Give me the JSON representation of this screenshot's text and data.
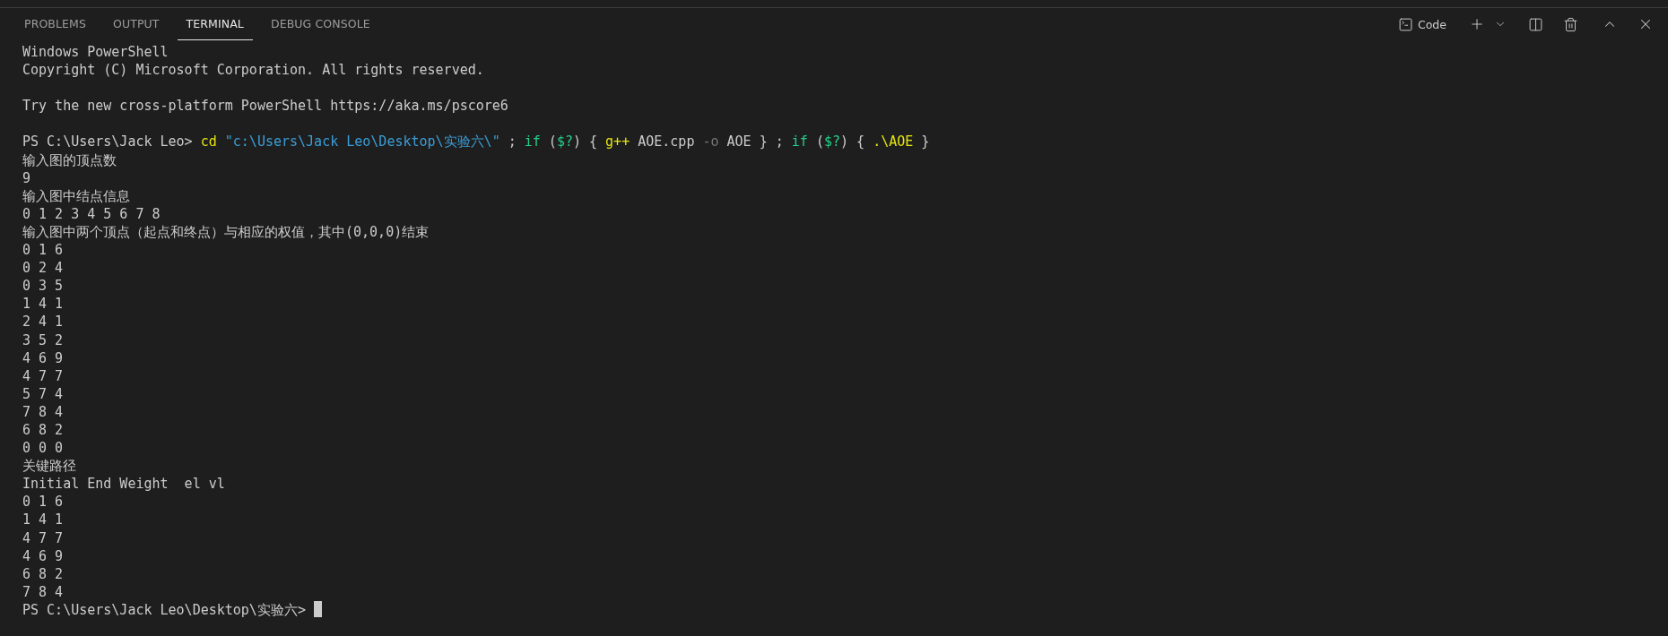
{
  "panel_tabs": [
    {
      "label": "PROBLEMS",
      "selected": false
    },
    {
      "label": "OUTPUT",
      "selected": false
    },
    {
      "label": "TERMINAL",
      "selected": true
    },
    {
      "label": "DEBUG CONSOLE",
      "selected": false
    }
  ],
  "toolbar": {
    "shell_label": "Code"
  },
  "terminal": {
    "cursor": true,
    "lines": [
      {
        "kind": "text",
        "segments": [
          {
            "text": "Windows PowerShell",
            "kind": "plain"
          }
        ]
      },
      {
        "kind": "text",
        "segments": [
          {
            "text": "Copyright (C) Microsoft Corporation. All rights reserved.",
            "kind": "plain"
          }
        ]
      },
      {
        "kind": "blank"
      },
      {
        "kind": "text",
        "segments": [
          {
            "text": "Try the new cross-platform PowerShell https://aka.ms/pscore6",
            "kind": "plain"
          }
        ]
      },
      {
        "kind": "blank"
      },
      {
        "kind": "text",
        "segments": [
          {
            "text": "PS C:\\Users\\Jack Leo> ",
            "kind": "plain"
          },
          {
            "text": "cd",
            "kind": "command"
          },
          {
            "text": " \"c:\\Users\\Jack Leo\\Desktop\\实验六\\\"",
            "kind": "string"
          },
          {
            "text": " ; ",
            "kind": "plain"
          },
          {
            "text": "if",
            "kind": "keyword"
          },
          {
            "text": " (",
            "kind": "plain"
          },
          {
            "text": "$?",
            "kind": "variable"
          },
          {
            "text": ") { ",
            "kind": "plain"
          },
          {
            "text": "g++",
            "kind": "command"
          },
          {
            "text": " AOE.cpp ",
            "kind": "plain"
          },
          {
            "text": "-o",
            "kind": "parameter"
          },
          {
            "text": " AOE } ; ",
            "kind": "plain"
          },
          {
            "text": "if",
            "kind": "keyword"
          },
          {
            "text": " (",
            "kind": "plain"
          },
          {
            "text": "$?",
            "kind": "variable"
          },
          {
            "text": ") { ",
            "kind": "plain"
          },
          {
            "text": ".\\AOE",
            "kind": "command"
          },
          {
            "text": " }",
            "kind": "plain"
          }
        ]
      },
      {
        "kind": "text",
        "segments": [
          {
            "text": "输入图的顶点数",
            "kind": "plain"
          }
        ]
      },
      {
        "kind": "text",
        "segments": [
          {
            "text": "9",
            "kind": "plain"
          }
        ]
      },
      {
        "kind": "text",
        "segments": [
          {
            "text": "输入图中结点信息",
            "kind": "plain"
          }
        ]
      },
      {
        "kind": "text",
        "segments": [
          {
            "text": "0 1 2 3 4 5 6 7 8",
            "kind": "plain"
          }
        ]
      },
      {
        "kind": "text",
        "segments": [
          {
            "text": "输入图中两个顶点（起点和终点）与相应的权值，其中(0,0,0)结束",
            "kind": "plain"
          }
        ]
      },
      {
        "kind": "text",
        "segments": [
          {
            "text": "0 1 6",
            "kind": "plain"
          }
        ]
      },
      {
        "kind": "text",
        "segments": [
          {
            "text": "0 2 4",
            "kind": "plain"
          }
        ]
      },
      {
        "kind": "text",
        "segments": [
          {
            "text": "0 3 5",
            "kind": "plain"
          }
        ]
      },
      {
        "kind": "text",
        "segments": [
          {
            "text": "1 4 1",
            "kind": "plain"
          }
        ]
      },
      {
        "kind": "text",
        "segments": [
          {
            "text": "2 4 1",
            "kind": "plain"
          }
        ]
      },
      {
        "kind": "text",
        "segments": [
          {
            "text": "3 5 2",
            "kind": "plain"
          }
        ]
      },
      {
        "kind": "text",
        "segments": [
          {
            "text": "4 6 9",
            "kind": "plain"
          }
        ]
      },
      {
        "kind": "text",
        "segments": [
          {
            "text": "4 7 7",
            "kind": "plain"
          }
        ]
      },
      {
        "kind": "text",
        "segments": [
          {
            "text": "5 7 4",
            "kind": "plain"
          }
        ]
      },
      {
        "kind": "text",
        "segments": [
          {
            "text": "7 8 4",
            "kind": "plain"
          }
        ]
      },
      {
        "kind": "text",
        "segments": [
          {
            "text": "6 8 2",
            "kind": "plain"
          }
        ]
      },
      {
        "kind": "text",
        "segments": [
          {
            "text": "0 0 0",
            "kind": "plain"
          }
        ]
      },
      {
        "kind": "text",
        "segments": [
          {
            "text": "关键路径",
            "kind": "plain"
          }
        ]
      },
      {
        "kind": "text",
        "segments": [
          {
            "text": "Initial End Weight  el vl",
            "kind": "plain"
          }
        ]
      },
      {
        "kind": "text",
        "segments": [
          {
            "text": "0 1 6",
            "kind": "plain"
          }
        ]
      },
      {
        "kind": "text",
        "segments": [
          {
            "text": "1 4 1",
            "kind": "plain"
          }
        ]
      },
      {
        "kind": "text",
        "segments": [
          {
            "text": "4 7 7",
            "kind": "plain"
          }
        ]
      },
      {
        "kind": "text",
        "segments": [
          {
            "text": "4 6 9",
            "kind": "plain"
          }
        ]
      },
      {
        "kind": "text",
        "segments": [
          {
            "text": "6 8 2",
            "kind": "plain"
          }
        ]
      },
      {
        "kind": "text",
        "segments": [
          {
            "text": "7 8 4",
            "kind": "plain"
          }
        ]
      },
      {
        "kind": "text",
        "segments": [
          {
            "text": "PS C:\\Users\\Jack Leo\\Desktop\\实验六> ",
            "kind": "plain"
          }
        ]
      }
    ]
  }
}
